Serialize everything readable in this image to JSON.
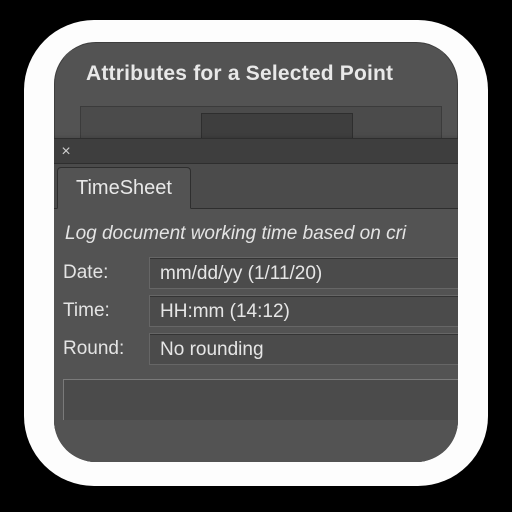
{
  "attributes": {
    "title": "Attributes for a Selected Point"
  },
  "timesheet": {
    "close_glyph": "×",
    "tab_label": "TimeSheet",
    "subtitle": "Log document working time based on cri",
    "rows": {
      "date": {
        "label": "Date:",
        "value": "mm/dd/yy (1/11/20)"
      },
      "time": {
        "label": "Time:",
        "value": "HH:mm (14:12)"
      },
      "round": {
        "label": "Round:",
        "value": "No rounding"
      }
    }
  }
}
